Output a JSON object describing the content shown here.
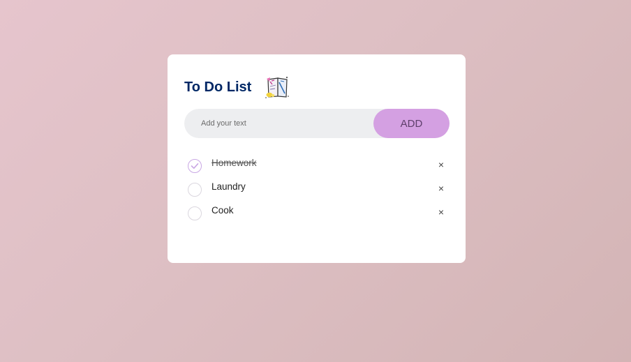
{
  "app": {
    "title": "To Do List",
    "title_icon": "notebook-doodle-icon"
  },
  "input": {
    "placeholder": "Add your text",
    "value": "",
    "add_label": "ADD"
  },
  "tasks": [
    {
      "label": "Homework",
      "done": true
    },
    {
      "label": "Laundry",
      "done": false
    },
    {
      "label": "Cook",
      "done": false
    }
  ],
  "icons": {
    "check": "check-icon",
    "close": "close-icon",
    "close_glyph": "×"
  },
  "colors": {
    "title": "#002765",
    "add_button": "#d4a0e2",
    "input_background": "#edeef0",
    "checked_border": "#c9a7e4"
  }
}
